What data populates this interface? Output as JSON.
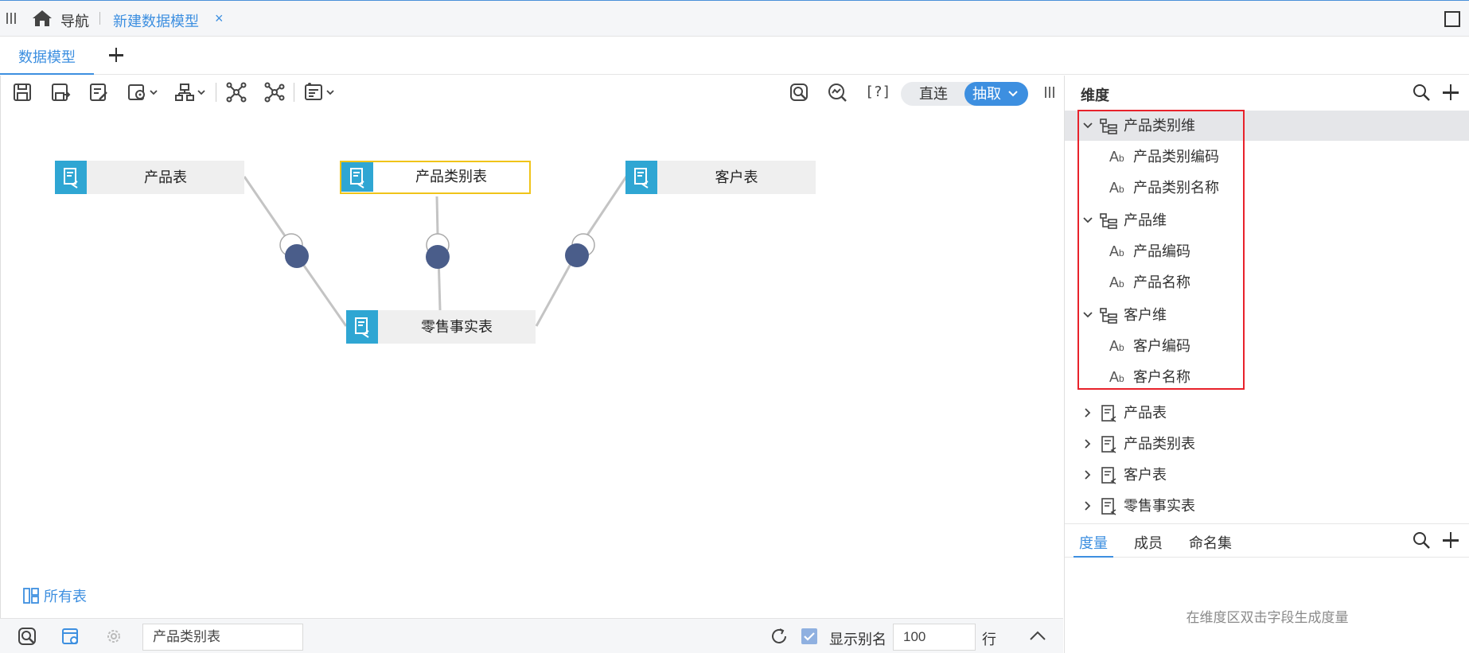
{
  "topbar": {
    "nav_label": "导航",
    "tab_title": "新建数据模型",
    "tab_close": "×"
  },
  "tabbar": {
    "model_tab": "数据模型"
  },
  "toolbar": {
    "help": "[?]",
    "mode_direct": "直连",
    "mode_extract": "抽取"
  },
  "canvas": {
    "tables": [
      {
        "name": "产品表"
      },
      {
        "name": "产品类别表",
        "selected": true
      },
      {
        "name": "客户表"
      },
      {
        "name": "零售事实表"
      }
    ],
    "all_tables_link": "所有表"
  },
  "statusbar": {
    "current_table": "产品类别表",
    "show_alias_checked": true,
    "show_alias_label": "显示别名",
    "row_count": "100",
    "row_unit": "行"
  },
  "dimension_panel": {
    "title": "维度",
    "hierarchies": [
      {
        "name": "产品类别维",
        "expanded": true,
        "fields": [
          "产品类别编码",
          "产品类别名称"
        ]
      },
      {
        "name": "产品维",
        "expanded": true,
        "fields": [
          "产品编码",
          "产品名称"
        ]
      },
      {
        "name": "客户维",
        "expanded": true,
        "fields": [
          "客户编码",
          "客户名称"
        ]
      }
    ],
    "tables": [
      "产品表",
      "产品类别表",
      "客户表",
      "零售事实表"
    ]
  },
  "measure_panel": {
    "tabs": [
      "度量",
      "成员",
      "命名集"
    ],
    "active_tab": "度量",
    "hint": "在维度区双击字段生成度量"
  },
  "colors": {
    "accent": "#3d8fe0",
    "table_icon": "#2fa6d3",
    "selected_border": "#f0c419",
    "join_node": "#4a5d8a",
    "highlight_box": "#e8222b"
  }
}
